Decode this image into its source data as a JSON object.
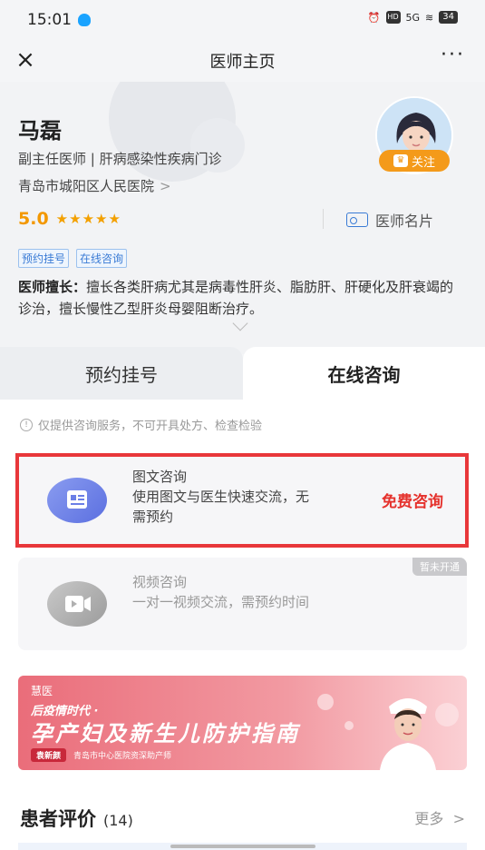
{
  "status_bar": {
    "time": "15:01",
    "hd": "HD",
    "signal": "5G",
    "battery": "34"
  },
  "nav": {
    "title": "医师主页",
    "close": "×",
    "more": "···"
  },
  "doctor": {
    "name": "马磊",
    "title": "副主任医师 | 肝病感染性疾病门诊",
    "hospital": "青岛市城阳区人民医院",
    "rating": "5.0",
    "stars": "★★★★★",
    "card_label": "医师名片",
    "follow_label": "关注",
    "tags": [
      "预约挂号",
      "在线咨询"
    ],
    "specialty_label": "医师擅长：",
    "specialty_text": "擅长各类肝病尤其是病毒性肝炎、脂肪肝、肝硬化及肝衰竭的诊治，擅长慢性乙型肝炎母婴阻断治疗。"
  },
  "tabs": {
    "appointment": "预约挂号",
    "online": "在线咨询"
  },
  "notice": "仅提供咨询服务，不可开具处方、检查检验",
  "consult_options": [
    {
      "title": "图文咨询",
      "desc": "使用图文与医生快速交流，无需预约",
      "action": "免费咨询"
    },
    {
      "title": "视频咨询",
      "desc": "一对一视频交流，需预约时间",
      "badge": "暂未开通"
    }
  ],
  "banner": {
    "brand": "慧医",
    "subtitle": "后疫情时代 ·",
    "title": "孕产妇及新生儿防护指南",
    "author_name": "袁新颜",
    "author_desc": "青岛市中心医院资深助产师"
  },
  "reviews": {
    "title": "患者评价",
    "count": "(14)",
    "more": "更多"
  },
  "colors": {
    "accent_red": "#e5322d",
    "highlight_border": "#e8373a",
    "star": "#f3a000",
    "link_blue": "#3a7bd5"
  }
}
